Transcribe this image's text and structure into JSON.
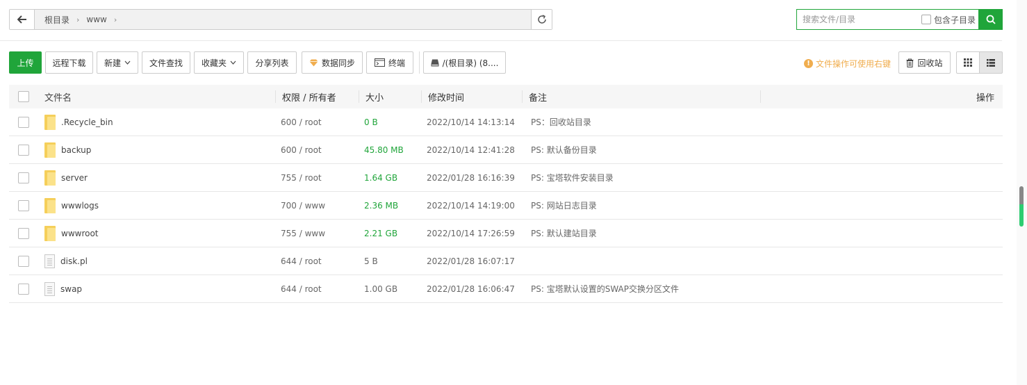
{
  "address": {
    "crumbs": [
      "根目录",
      "www"
    ]
  },
  "search": {
    "placeholder": "搜索文件/目录",
    "subdir_label": "包含子目录"
  },
  "toolbar": {
    "upload": "上传",
    "remote_download": "远程下载",
    "new": "新建",
    "file_search": "文件查找",
    "favorites": "收藏夹",
    "share_list": "分享列表",
    "data_sync": "数据同步",
    "terminal": "终端",
    "disk": "/(根目录) (8....",
    "tip": "文件操作可使用右键",
    "recycle": "回收站"
  },
  "table": {
    "headers": {
      "name": "文件名",
      "perm": "权限 / 所有者",
      "size": "大小",
      "time": "修改时间",
      "note": "备注",
      "op": "操作"
    },
    "rows": [
      {
        "type": "folder",
        "name": ".Recycle_bin",
        "perm": "600 / root",
        "size": "0 B",
        "size_green": true,
        "time": "2022/10/14 14:13:14",
        "note": "PS：回收站目录"
      },
      {
        "type": "folder",
        "name": "backup",
        "perm": "600 / root",
        "size": "45.80 MB",
        "size_green": true,
        "time": "2022/10/14 12:41:28",
        "note": "PS: 默认备份目录"
      },
      {
        "type": "folder",
        "name": "server",
        "perm": "755 / root",
        "size": "1.64 GB",
        "size_green": true,
        "time": "2022/01/28 16:16:39",
        "note": "PS: 宝塔软件安装目录"
      },
      {
        "type": "folder",
        "name": "wwwlogs",
        "perm": "700 / www",
        "size": "2.36 MB",
        "size_green": true,
        "time": "2022/10/14 14:19:00",
        "note": "PS: 网站日志目录"
      },
      {
        "type": "folder",
        "name": "wwwroot",
        "perm": "755 / www",
        "size": "2.21 GB",
        "size_green": true,
        "time": "2022/10/14 17:26:59",
        "note": "PS: 默认建站目录"
      },
      {
        "type": "file",
        "name": "disk.pl",
        "perm": "644 / root",
        "size": "5 B",
        "size_green": false,
        "time": "2022/01/28 16:07:17",
        "note": ""
      },
      {
        "type": "file",
        "name": "swap",
        "perm": "644 / root",
        "size": "1.00 GB",
        "size_green": false,
        "time": "2022/01/28 16:06:47",
        "note": "PS: 宝塔默认设置的SWAP交换分区文件"
      }
    ]
  },
  "colors": {
    "accent": "#20a53a",
    "tip": "#f0ad4e"
  }
}
